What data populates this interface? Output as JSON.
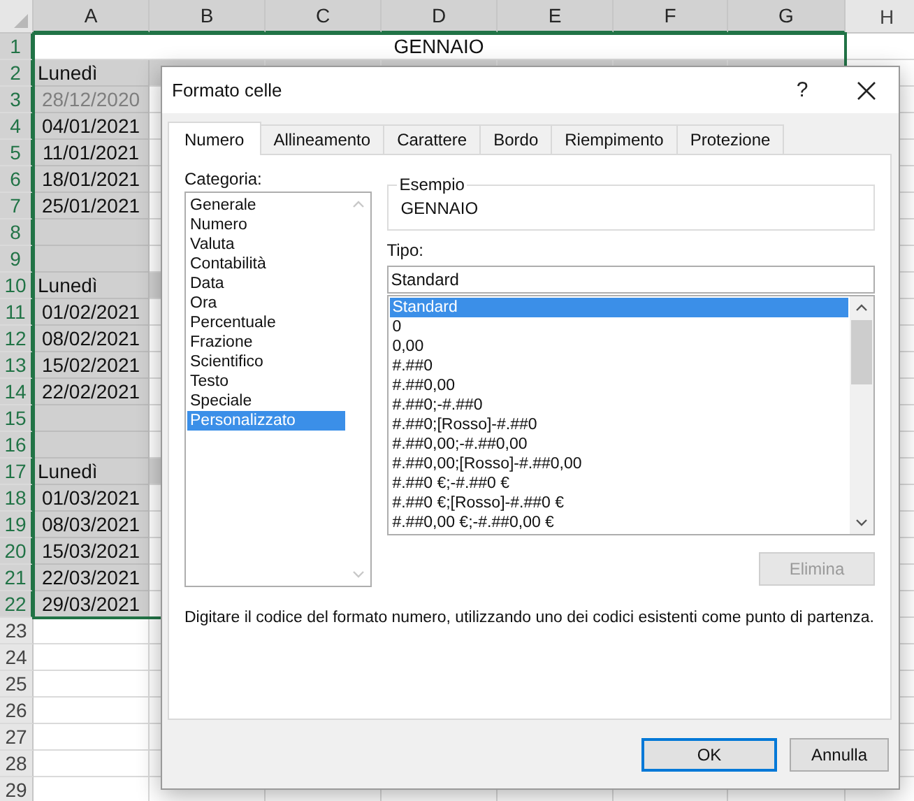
{
  "sheet": {
    "columns": [
      {
        "label": "A",
        "selected": true
      },
      {
        "label": "B",
        "selected": true
      },
      {
        "label": "C",
        "selected": true
      },
      {
        "label": "D",
        "selected": true
      },
      {
        "label": "E",
        "selected": true
      },
      {
        "label": "F",
        "selected": true
      },
      {
        "label": "G",
        "selected": true
      },
      {
        "label": "H",
        "selected": false
      }
    ],
    "rows": [
      {
        "number": "1",
        "selected": true,
        "kind": "title",
        "cells": [
          "",
          "",
          "",
          "GENNAIO"
        ]
      },
      {
        "number": "2",
        "selected": true,
        "kind": "day_header",
        "cells": [
          "Lunedì"
        ]
      },
      {
        "number": "3",
        "selected": true,
        "kind": "other_month_date",
        "cells": [
          "28/12/2020"
        ]
      },
      {
        "number": "4",
        "selected": true,
        "kind": "date",
        "cells": [
          "04/01/2021"
        ]
      },
      {
        "number": "5",
        "selected": true,
        "kind": "date",
        "cells": [
          "11/01/2021"
        ]
      },
      {
        "number": "6",
        "selected": true,
        "kind": "date",
        "cells": [
          "18/01/2021"
        ]
      },
      {
        "number": "7",
        "selected": true,
        "kind": "date",
        "cells": [
          "25/01/2021"
        ]
      },
      {
        "number": "8",
        "selected": true,
        "kind": "shaded_blank",
        "cells": []
      },
      {
        "number": "9",
        "selected": true,
        "kind": "shaded_blank",
        "cells": []
      },
      {
        "number": "10",
        "selected": true,
        "kind": "day_header",
        "cells": [
          "Lunedì"
        ]
      },
      {
        "number": "11",
        "selected": true,
        "kind": "date",
        "cells": [
          "01/02/2021"
        ]
      },
      {
        "number": "12",
        "selected": true,
        "kind": "date",
        "cells": [
          "08/02/2021"
        ]
      },
      {
        "number": "13",
        "selected": true,
        "kind": "date",
        "cells": [
          "15/02/2021"
        ]
      },
      {
        "number": "14",
        "selected": true,
        "kind": "date",
        "cells": [
          "22/02/2021"
        ]
      },
      {
        "number": "15",
        "selected": true,
        "kind": "shaded_blank",
        "cells": []
      },
      {
        "number": "16",
        "selected": true,
        "kind": "shaded_blank",
        "cells": []
      },
      {
        "number": "17",
        "selected": true,
        "kind": "day_header",
        "cells": [
          "Lunedì"
        ]
      },
      {
        "number": "18",
        "selected": true,
        "kind": "date",
        "cells": [
          "01/03/2021"
        ]
      },
      {
        "number": "19",
        "selected": true,
        "kind": "date",
        "cells": [
          "08/03/2021"
        ]
      },
      {
        "number": "20",
        "selected": true,
        "kind": "date",
        "cells": [
          "15/03/2021"
        ]
      },
      {
        "number": "21",
        "selected": true,
        "kind": "date",
        "cells": [
          "22/03/2021"
        ]
      },
      {
        "number": "22",
        "selected": true,
        "kind": "date",
        "cells": [
          "29/03/2021"
        ]
      },
      {
        "number": "23",
        "selected": false,
        "kind": "blank",
        "cells": []
      },
      {
        "number": "24",
        "selected": false,
        "kind": "blank",
        "cells": []
      },
      {
        "number": "25",
        "selected": false,
        "kind": "blank",
        "cells": []
      },
      {
        "number": "26",
        "selected": false,
        "kind": "blank",
        "cells": []
      },
      {
        "number": "27",
        "selected": false,
        "kind": "blank",
        "cells": []
      },
      {
        "number": "28",
        "selected": false,
        "kind": "blank",
        "cells": []
      },
      {
        "number": "29",
        "selected": false,
        "kind": "blank",
        "cells": []
      }
    ]
  },
  "dialog": {
    "title": "Formato celle",
    "help_button": "?",
    "tabs": [
      {
        "label": "Numero",
        "selected": true
      },
      {
        "label": "Allineamento",
        "selected": false
      },
      {
        "label": "Carattere",
        "selected": false
      },
      {
        "label": "Bordo",
        "selected": false
      },
      {
        "label": "Riempimento",
        "selected": false
      },
      {
        "label": "Protezione",
        "selected": false
      }
    ],
    "category_label": "Categoria:",
    "categories": [
      {
        "label": "Generale",
        "selected": false
      },
      {
        "label": "Numero",
        "selected": false
      },
      {
        "label": "Valuta",
        "selected": false
      },
      {
        "label": "Contabilità",
        "selected": false
      },
      {
        "label": "Data",
        "selected": false
      },
      {
        "label": "Ora",
        "selected": false
      },
      {
        "label": "Percentuale",
        "selected": false
      },
      {
        "label": "Frazione",
        "selected": false
      },
      {
        "label": "Scientifico",
        "selected": false
      },
      {
        "label": "Testo",
        "selected": false
      },
      {
        "label": "Speciale",
        "selected": false
      },
      {
        "label": "Personalizzato",
        "selected": true
      }
    ],
    "sample": {
      "legend": "Esempio",
      "value": "GENNAIO"
    },
    "type_label": "Tipo:",
    "type_value": "Standard",
    "formats": [
      {
        "label": "Standard",
        "selected": true
      },
      {
        "label": "0",
        "selected": false
      },
      {
        "label": "0,00",
        "selected": false
      },
      {
        "label": "#.##0",
        "selected": false
      },
      {
        "label": "#.##0,00",
        "selected": false
      },
      {
        "label": "#.##0;-#.##0",
        "selected": false
      },
      {
        "label": "#.##0;[Rosso]-#.##0",
        "selected": false
      },
      {
        "label": "#.##0,00;-#.##0,00",
        "selected": false
      },
      {
        "label": "#.##0,00;[Rosso]-#.##0,00",
        "selected": false
      },
      {
        "label": "#.##0 €;-#.##0 €",
        "selected": false
      },
      {
        "label": "#.##0 €;[Rosso]-#.##0 €",
        "selected": false
      },
      {
        "label": "#.##0,00 €;-#.##0,00 €",
        "selected": false
      }
    ],
    "delete_button": {
      "label": "Elimina",
      "disabled": true
    },
    "description": "Digitare il codice del formato numero, utilizzando uno dei codici esistenti come punto di partenza.",
    "buttons": [
      {
        "label": "OK",
        "selected": true
      },
      {
        "label": "Annulla",
        "selected": false
      }
    ]
  }
}
